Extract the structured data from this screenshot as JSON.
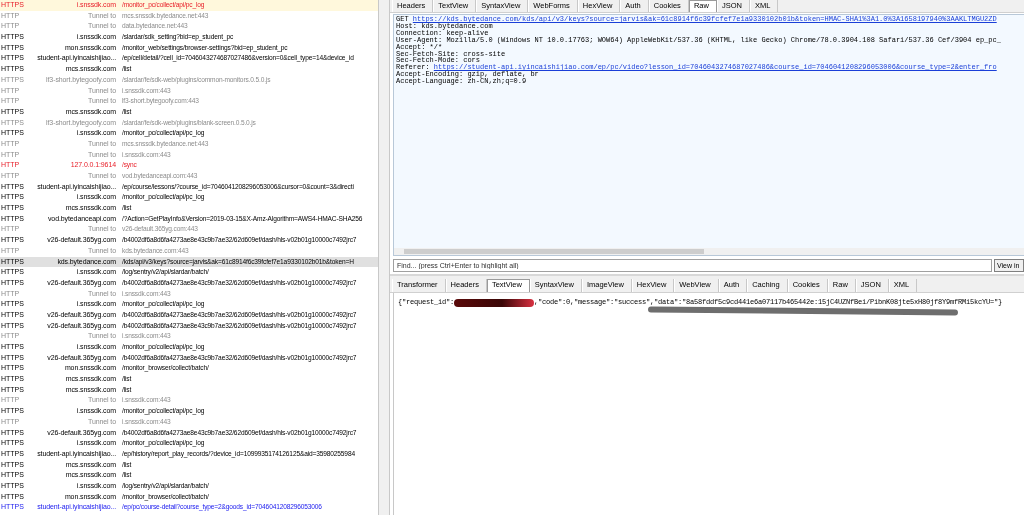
{
  "sessions": [
    {
      "protocol": "HTTPS",
      "host": "i.snssdk.com",
      "url": "/monitor_pc/collect/api/pc_log",
      "kind": "error",
      "selected": false,
      "highlighted": true
    },
    {
      "protocol": "HTTP",
      "host": "Tunnel to",
      "url": "mcs.snssdk.bytedance.net:443",
      "kind": "muted",
      "selected": false,
      "highlighted": false
    },
    {
      "protocol": "HTTP",
      "host": "Tunnel to",
      "url": "data.bytedance.net:443",
      "kind": "muted",
      "selected": false,
      "highlighted": false
    },
    {
      "protocol": "HTTPS",
      "host": "i.snssdk.com",
      "url": "/slardar/sdk_setting?bid=ep_student_pc",
      "kind": "normal",
      "selected": false,
      "highlighted": false
    },
    {
      "protocol": "HTTPS",
      "host": "mon.snssdk.com",
      "url": "/monitor_web/settings/browser-settings?bid=ep_student_pc",
      "kind": "normal",
      "selected": false,
      "highlighted": false
    },
    {
      "protocol": "HTTPS",
      "host": "student-api.iyincaishijiao...",
      "url": "/ep/cell/detail/?cell_id=7046043274687027486&version=0&cell_type=14&device_id",
      "kind": "normal",
      "selected": false,
      "highlighted": false
    },
    {
      "protocol": "HTTPS",
      "host": "mcs.snssdk.com",
      "url": "/list",
      "kind": "normal",
      "selected": false,
      "highlighted": false
    },
    {
      "protocol": "HTTPS",
      "host": "lf3-short.bytegoofy.com",
      "url": "/slardar/fe/sdk-web/plugins/common-monitors.0.5.0.js",
      "kind": "muted",
      "selected": false,
      "highlighted": false
    },
    {
      "protocol": "HTTP",
      "host": "Tunnel to",
      "url": "i.snssdk.com:443",
      "kind": "muted",
      "selected": false,
      "highlighted": false
    },
    {
      "protocol": "HTTP",
      "host": "Tunnel to",
      "url": "lf3-short.bytegoofy.com:443",
      "kind": "muted",
      "selected": false,
      "highlighted": false
    },
    {
      "protocol": "HTTPS",
      "host": "mcs.snssdk.com",
      "url": "/list",
      "kind": "normal",
      "selected": false,
      "highlighted": false
    },
    {
      "protocol": "HTTPS",
      "host": "lf3-short.bytegoofy.com",
      "url": "/slardar/fe/sdk-web/plugins/blank-screen.0.5.0.js",
      "kind": "muted",
      "selected": false,
      "highlighted": false
    },
    {
      "protocol": "HTTPS",
      "host": "i.snssdk.com",
      "url": "/monitor_pc/collect/api/pc_log",
      "kind": "normal",
      "selected": false,
      "highlighted": false
    },
    {
      "protocol": "HTTP",
      "host": "Tunnel to",
      "url": "mcs.snssdk.bytedance.net:443",
      "kind": "muted",
      "selected": false,
      "highlighted": false
    },
    {
      "protocol": "HTTP",
      "host": "Tunnel to",
      "url": "i.snssdk.com:443",
      "kind": "muted",
      "selected": false,
      "highlighted": false
    },
    {
      "protocol": "HTTP",
      "host": "127.0.0.1:9614",
      "url": "/sync",
      "kind": "error",
      "selected": false,
      "highlighted": false
    },
    {
      "protocol": "HTTP",
      "host": "Tunnel to",
      "url": "vod.bytedanceapi.com:443",
      "kind": "muted",
      "selected": false,
      "highlighted": false
    },
    {
      "protocol": "HTTPS",
      "host": "student-api.iyincaishijiao...",
      "url": "/ep/course/lessons/?course_id=7046041208296053006&cursor=0&count=3&directi",
      "kind": "normal",
      "selected": false,
      "highlighted": false
    },
    {
      "protocol": "HTTPS",
      "host": "i.snssdk.com",
      "url": "/monitor_pc/collect/api/pc_log",
      "kind": "normal",
      "selected": false,
      "highlighted": false
    },
    {
      "protocol": "HTTPS",
      "host": "mcs.snssdk.com",
      "url": "/list",
      "kind": "normal",
      "selected": false,
      "highlighted": false
    },
    {
      "protocol": "HTTPS",
      "host": "vod.bytedanceapi.com",
      "url": "/?Action=GetPlayInfo&Version=2019-03-15&X-Amz-Algorithm=AWS4-HMAC-SHA256",
      "kind": "normal",
      "selected": false,
      "highlighted": false
    },
    {
      "protocol": "HTTP",
      "host": "Tunnel to",
      "url": "v26-default.365yg.com:443",
      "kind": "muted",
      "selected": false,
      "highlighted": false
    },
    {
      "protocol": "HTTPS",
      "host": "v26-default.365yg.com",
      "url": "/b4002df6a8d6fa4273ae8e43c9b7ae32/62d609ef/dash/hls-v02b01g10000c7492jrc7",
      "kind": "normal",
      "selected": false,
      "highlighted": false
    },
    {
      "protocol": "HTTP",
      "host": "Tunnel to",
      "url": "kds.bytedance.com:443",
      "kind": "muted",
      "selected": false,
      "highlighted": false
    },
    {
      "protocol": "HTTPS",
      "host": "kds.bytedance.com",
      "url": "/kds/api/v3/keys?source=jarvis&ak=61c8914f6c39fcfef7e1a9330102b01b&token=H",
      "kind": "normal",
      "selected": true,
      "highlighted": false
    },
    {
      "protocol": "HTTPS",
      "host": "i.snssdk.com",
      "url": "/log/sentry/v2/api/slardar/batch/",
      "kind": "normal",
      "selected": false,
      "highlighted": false
    },
    {
      "protocol": "HTTPS",
      "host": "v26-default.365yg.com",
      "url": "/b4002df6a8d6fa4273ae8e43c9b7ae32/62d609ef/dash/hls-v02b01g10000c7492jrc7",
      "kind": "normal",
      "selected": false,
      "highlighted": false
    },
    {
      "protocol": "HTTP",
      "host": "Tunnel to",
      "url": "i.snssdk.com:443",
      "kind": "muted",
      "selected": false,
      "highlighted": false
    },
    {
      "protocol": "HTTPS",
      "host": "i.snssdk.com",
      "url": "/monitor_pc/collect/api/pc_log",
      "kind": "normal",
      "selected": false,
      "highlighted": false
    },
    {
      "protocol": "HTTPS",
      "host": "v26-default.365yg.com",
      "url": "/b4002df6a8d6fa4273ae8e43c9b7ae32/62d609ef/dash/hls-v02b01g10000c7492jrc7",
      "kind": "normal",
      "selected": false,
      "highlighted": false
    },
    {
      "protocol": "HTTPS",
      "host": "v26-default.365yg.com",
      "url": "/b4002df6a8d6fa4273ae8e43c9b7ae32/62d609ef/dash/hls-v02b01g10000c7492jrc7",
      "kind": "normal",
      "selected": false,
      "highlighted": false
    },
    {
      "protocol": "HTTP",
      "host": "Tunnel to",
      "url": "i.snssdk.com:443",
      "kind": "muted",
      "selected": false,
      "highlighted": false
    },
    {
      "protocol": "HTTPS",
      "host": "i.snssdk.com",
      "url": "/monitor_pc/collect/api/pc_log",
      "kind": "normal",
      "selected": false,
      "highlighted": false
    },
    {
      "protocol": "HTTPS",
      "host": "v26-default.365yg.com",
      "url": "/b4002df6a8d6fa4273ae8e43c9b7ae32/62d609ef/dash/hls-v02b01g10000c7492jrc7",
      "kind": "normal",
      "selected": false,
      "highlighted": false
    },
    {
      "protocol": "HTTPS",
      "host": "mon.snssdk.com",
      "url": "/monitor_browser/collect/batch/",
      "kind": "normal",
      "selected": false,
      "highlighted": false
    },
    {
      "protocol": "HTTPS",
      "host": "mcs.snssdk.com",
      "url": "/list",
      "kind": "normal",
      "selected": false,
      "highlighted": false
    },
    {
      "protocol": "HTTPS",
      "host": "mcs.snssdk.com",
      "url": "/list",
      "kind": "normal",
      "selected": false,
      "highlighted": false
    },
    {
      "protocol": "HTTP",
      "host": "Tunnel to",
      "url": "i.snssdk.com:443",
      "kind": "muted",
      "selected": false,
      "highlighted": false
    },
    {
      "protocol": "HTTPS",
      "host": "i.snssdk.com",
      "url": "/monitor_pc/collect/api/pc_log",
      "kind": "normal",
      "selected": false,
      "highlighted": false
    },
    {
      "protocol": "HTTP",
      "host": "Tunnel to",
      "url": "i.snssdk.com:443",
      "kind": "muted",
      "selected": false,
      "highlighted": false
    },
    {
      "protocol": "HTTPS",
      "host": "v26-default.365yg.com",
      "url": "/b4002df6a8d6fa4273ae8e43c9b7ae32/62d609ef/dash/hls-v02b01g10000c7492jrc7",
      "kind": "normal",
      "selected": false,
      "highlighted": false
    },
    {
      "protocol": "HTTPS",
      "host": "i.snssdk.com",
      "url": "/monitor_pc/collect/api/pc_log",
      "kind": "normal",
      "selected": false,
      "highlighted": false
    },
    {
      "protocol": "HTTPS",
      "host": "student-api.iyincaishijiao...",
      "url": "/ep/history/report_play_records/?device_id=1099935174126125&aid=35980255984",
      "kind": "normal",
      "selected": false,
      "highlighted": false
    },
    {
      "protocol": "HTTPS",
      "host": "mcs.snssdk.com",
      "url": "/list",
      "kind": "normal",
      "selected": false,
      "highlighted": false
    },
    {
      "protocol": "HTTPS",
      "host": "mcs.snssdk.com",
      "url": "/list",
      "kind": "normal",
      "selected": false,
      "highlighted": false
    },
    {
      "protocol": "HTTPS",
      "host": "i.snssdk.com",
      "url": "/log/sentry/v2/api/slardar/batch/",
      "kind": "normal",
      "selected": false,
      "highlighted": false
    },
    {
      "protocol": "HTTPS",
      "host": "mon.snssdk.com",
      "url": "/monitor_browser/collect/batch/",
      "kind": "normal",
      "selected": false,
      "highlighted": false
    },
    {
      "protocol": "HTTPS",
      "host": "student-api.iyincaishijiao...",
      "url": "/ep/pc/course-detail?course_type=2&goods_id=7046041208296053006",
      "kind": "link",
      "selected": false,
      "highlighted": false
    }
  ],
  "request_tabs": [
    {
      "label": "Headers",
      "selected": false
    },
    {
      "label": "TextView",
      "selected": false
    },
    {
      "label": "SyntaxView",
      "selected": false
    },
    {
      "label": "WebForms",
      "selected": false
    },
    {
      "label": "HexView",
      "selected": false
    },
    {
      "label": "Auth",
      "selected": false
    },
    {
      "label": "Cookies",
      "selected": false
    },
    {
      "label": "Raw",
      "selected": true
    },
    {
      "label": "JSON",
      "selected": false
    },
    {
      "label": "XML",
      "selected": false
    }
  ],
  "request_raw": [
    {
      "kind": "link",
      "prefix": "GET ",
      "link": "https://kds.bytedance.com/kds/api/v3/keys?source=jarvis&ak=61c8914f6c39fcfef7e1a9330102b01b&token=HMAC-SHA1%3A1.0%3A1658197940%3AAKLTMGU2ZD"
    },
    {
      "kind": "plain",
      "text": "Host: kds.bytedance.com"
    },
    {
      "kind": "plain",
      "text": "Connection: keep-alive"
    },
    {
      "kind": "plain",
      "text": "User-Agent: Mozilla/5.0 (Windows NT 10.0.17763; WOW64) AppleWebKit/537.36 (KHTML, like Gecko) Chrome/78.0.3904.108 Safari/537.36 Cef/3904 ep_pc_"
    },
    {
      "kind": "plain",
      "text": "Accept: */*"
    },
    {
      "kind": "plain",
      "text": "Sec-Fetch-Site: cross-site"
    },
    {
      "kind": "plain",
      "text": "Sec-Fetch-Mode: cors"
    },
    {
      "kind": "link",
      "prefix": "Referer: ",
      "link": "https://student-api.iyincaishijiao.com/ep/pc/video?lesson_id=7046043274687027486&course_id=7046041208296053006&course_type=2&enter_fro"
    },
    {
      "kind": "plain",
      "text": "Accept-Encoding: gzip, deflate, br"
    },
    {
      "kind": "plain",
      "text": "Accept-Language: zh-CN,zh;q=0.9"
    }
  ],
  "find_bar": {
    "placeholder": "Find... (press Ctrl+Enter to highlight all)",
    "button": "View in"
  },
  "response_tabs": [
    {
      "label": "Transformer",
      "selected": false
    },
    {
      "label": "Headers",
      "selected": false
    },
    {
      "label": "TextView",
      "selected": true
    },
    {
      "label": "SyntaxView",
      "selected": false
    },
    {
      "label": "ImageView",
      "selected": false
    },
    {
      "label": "HexView",
      "selected": false
    },
    {
      "label": "WebView",
      "selected": false
    },
    {
      "label": "Auth",
      "selected": false
    },
    {
      "label": "Caching",
      "selected": false
    },
    {
      "label": "Cookies",
      "selected": false
    },
    {
      "label": "Raw",
      "selected": false
    },
    {
      "label": "JSON",
      "selected": false
    },
    {
      "label": "XML",
      "selected": false
    }
  ],
  "response_body": {
    "text_start": "{\"request_id\":",
    "text_end": ",\"code\":0,\"message\":\"success\",\"data\":\"8a58fddf5c9cd441e6a07117b465442e:15jC4UZNfBei/PibnK08jte5xH80jf8Y9mfRMi5kcYU=\"}"
  }
}
